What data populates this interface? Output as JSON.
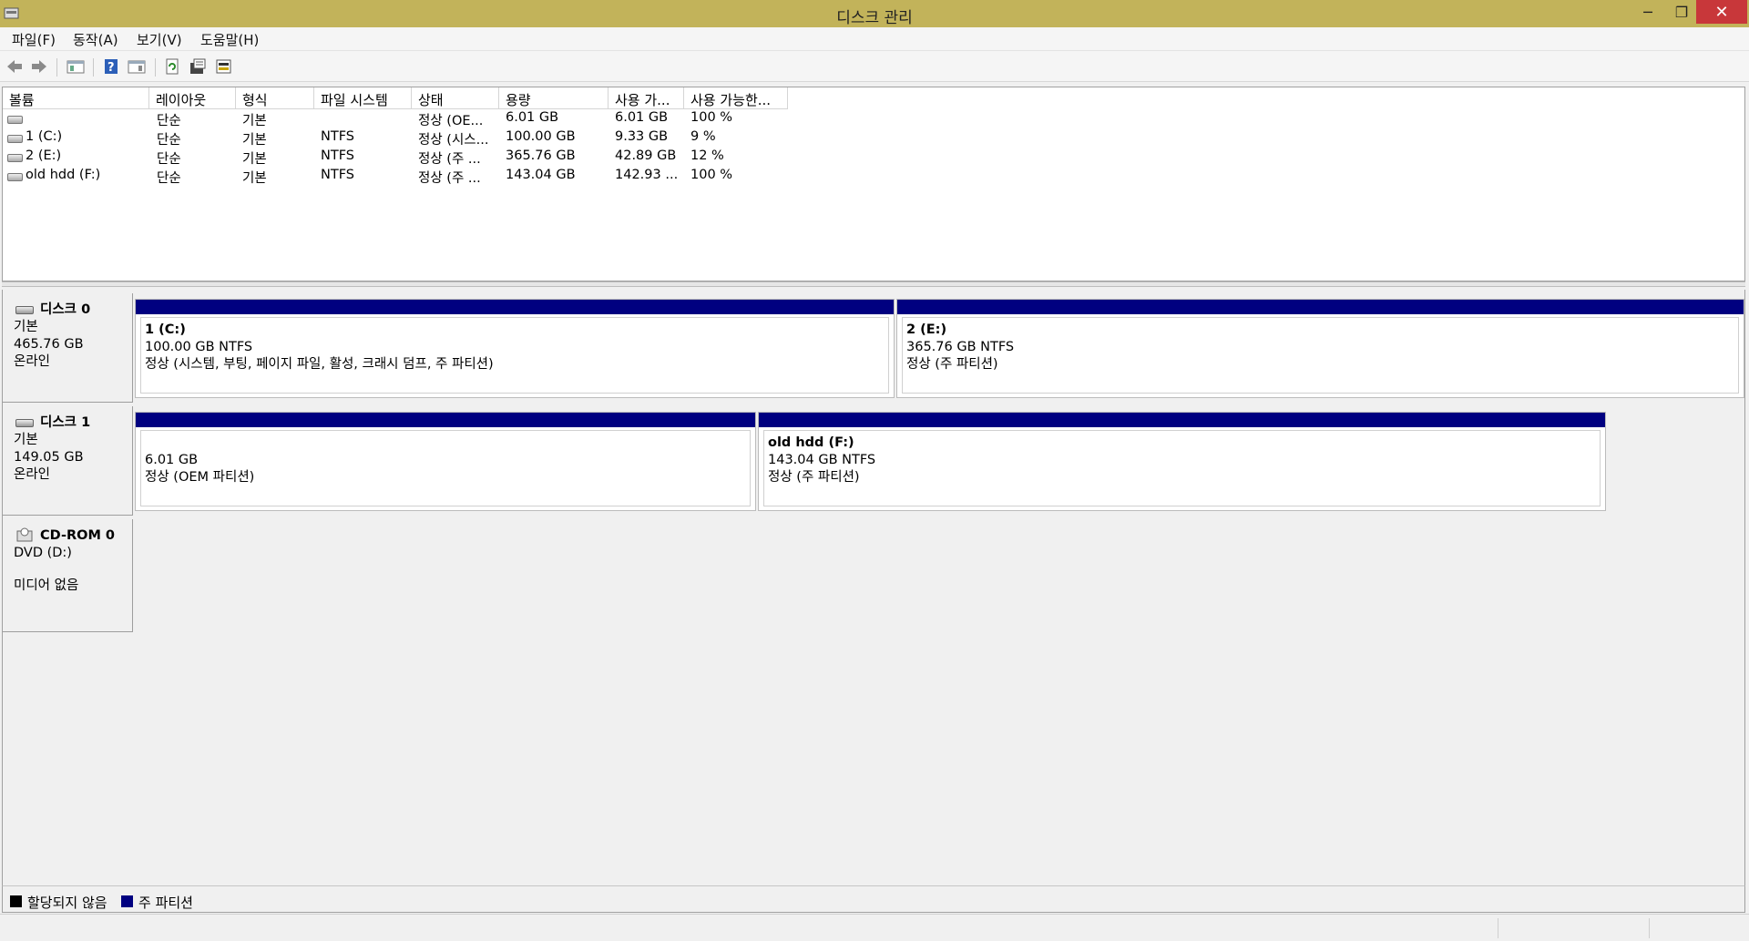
{
  "window": {
    "title": "디스크 관리",
    "controls": {
      "minimize": "─",
      "maximize": "❐",
      "close": "✕"
    }
  },
  "menu": [
    "파일(F)",
    "동작(A)",
    "보기(V)",
    "도움말(H)"
  ],
  "toolbar": {
    "icons": [
      "back-arrow-icon",
      "forward-arrow-icon",
      "console-tree-icon",
      "help-icon",
      "show-pane-icon",
      "refresh-icon",
      "properties-icon",
      "disk-settings-icon"
    ]
  },
  "volume_list": {
    "columns": [
      "볼륨",
      "레이아웃",
      "형식",
      "파일 시스템",
      "상태",
      "용량",
      "사용 가...",
      "사용 가능한..."
    ],
    "rows": [
      [
        "",
        "단순",
        "기본",
        "",
        "정상 (OE...",
        "6.01 GB",
        "6.01 GB",
        "100 %"
      ],
      [
        "1 (C:)",
        "단순",
        "기본",
        "NTFS",
        "정상 (시스...",
        "100.00 GB",
        "9.33 GB",
        "9 %"
      ],
      [
        "2 (E:)",
        "단순",
        "기본",
        "NTFS",
        "정상 (주 ...",
        "365.76 GB",
        "42.89 GB",
        "12 %"
      ],
      [
        "old hdd (F:)",
        "단순",
        "기본",
        "NTFS",
        "정상 (주 ...",
        "143.04 GB",
        "142.93 ...",
        "100 %"
      ]
    ]
  },
  "disks": [
    {
      "name": "디스크 0",
      "type": "기본",
      "size": "465.76 GB",
      "status": "온라인",
      "partitions": [
        {
          "name": "1  (C:)",
          "size": "100.00 GB NTFS",
          "status": "정상 (시스템, 부팅, 페이지 파일, 활성, 크래시 덤프, 주 파티션)"
        },
        {
          "name": "2  (E:)",
          "size": "365.76 GB NTFS",
          "status": "정상 (주 파티션)"
        }
      ]
    },
    {
      "name": "디스크 1",
      "type": "기본",
      "size": "149.05 GB",
      "status": "온라인",
      "partitions": [
        {
          "name": "",
          "size": "6.01 GB",
          "status": "정상 (OEM 파티션)"
        },
        {
          "name": "old hdd  (F:)",
          "size": "143.04 GB NTFS",
          "status": "정상 (주 파티션)"
        }
      ]
    },
    {
      "name": "CD-ROM 0",
      "type": "DVD (D:)",
      "status": "미디어 없음"
    }
  ],
  "legend": [
    {
      "label": "할당되지 않음",
      "color": "#000000"
    },
    {
      "label": "주 파티션",
      "color": "#000080"
    }
  ],
  "colors": {
    "titlebar": "#c2b35a",
    "primary_partition": "#000080",
    "close_button": "#c8373a"
  }
}
